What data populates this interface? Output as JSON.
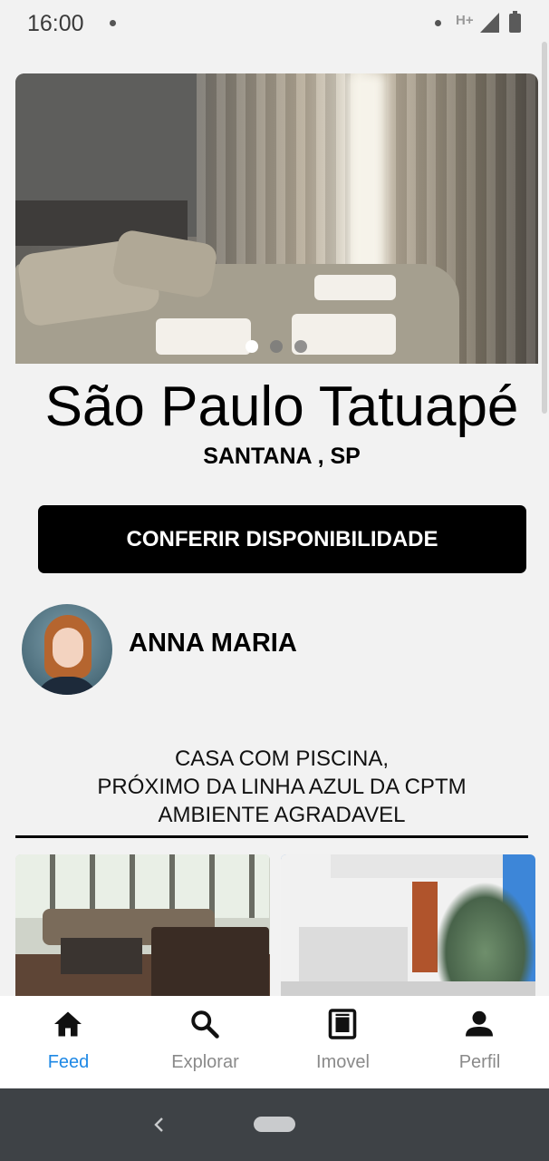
{
  "status_bar": {
    "time": "16:00",
    "network": "H+",
    "icons": [
      "notification-dot-icon",
      "signal-icon",
      "battery-icon"
    ]
  },
  "listing": {
    "title": "São Paulo Tatuapé",
    "location": "SANTANA , SP",
    "cta_label": "CONFERIR DISPONIBILIDADE",
    "carousel": {
      "count": 3,
      "active_index": 0
    },
    "owner_name": "ANNA MARIA",
    "description_lines": [
      "CASA COM PISCINA,",
      "PRÓXIMO DA LINHA AZUL DA CPTM",
      "AMBIENTE AGRADAVEL"
    ]
  },
  "bottom_nav": {
    "items": [
      {
        "label": "Feed",
        "icon": "home-icon",
        "active": true
      },
      {
        "label": "Explorar",
        "icon": "search-icon",
        "active": false
      },
      {
        "label": "Imovel",
        "icon": "building-icon",
        "active": false
      },
      {
        "label": "Perfil",
        "icon": "person-icon",
        "active": false
      }
    ]
  },
  "colors": {
    "accent": "#1e88e5",
    "inactive": "#8a8a8a",
    "button_bg": "#000000",
    "background": "#f2f2f2"
  }
}
